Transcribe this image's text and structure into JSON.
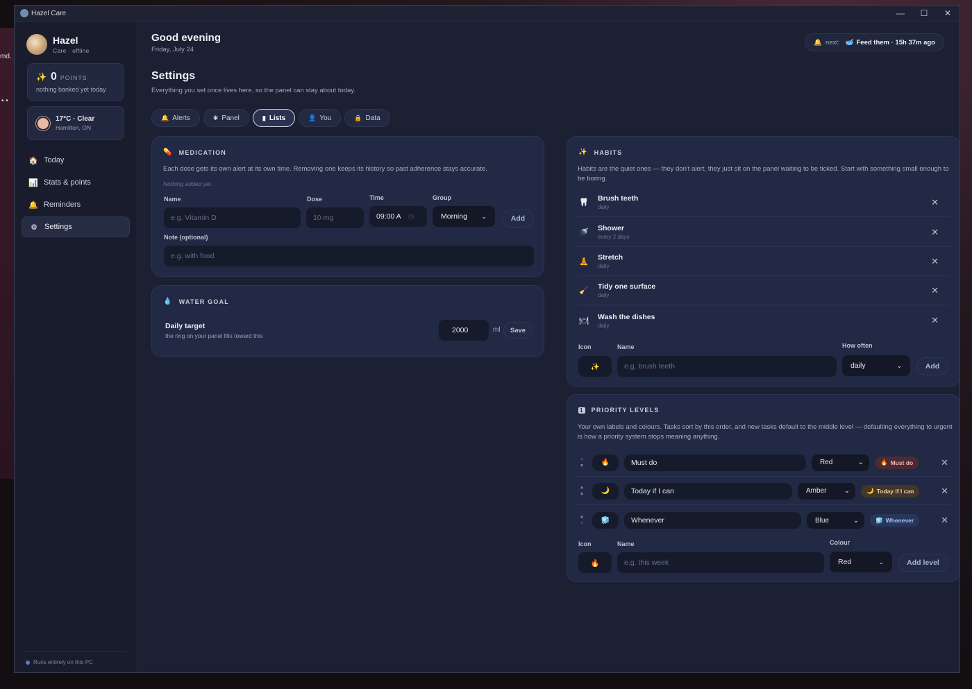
{
  "background": {
    "left_text": "md.",
    "left_dots": "• •"
  },
  "window": {
    "title": "Hazel Care",
    "controls": {
      "minimize": "—",
      "maximize": "☐",
      "close": "✕"
    }
  },
  "sidebar": {
    "name": "Hazel",
    "status": "Care · offline",
    "points": {
      "value": "0",
      "label": "POINTS",
      "sub": "nothing banked yet today"
    },
    "weather": {
      "temp": "17°C · Clear",
      "location": "Hamilton, ON"
    },
    "nav": [
      {
        "label": "Today",
        "icon": "🏠"
      },
      {
        "label": "Stats & points",
        "icon": "📊"
      },
      {
        "label": "Reminders",
        "icon": "🔔"
      },
      {
        "label": "Settings",
        "icon": "⚙"
      }
    ],
    "footer": "Runs entirely on this PC"
  },
  "header": {
    "greeting": "Good evening",
    "date": "Friday, July 24",
    "next_label": "next:",
    "next_value": "Feed them · 15h 37m ago"
  },
  "settings": {
    "title": "Settings",
    "subtitle": "Everything you set once lives here, so the panel can stay about today.",
    "tabs": [
      {
        "label": "Alerts",
        "icon": "🔔"
      },
      {
        "label": "Panel",
        "icon": "✱"
      },
      {
        "label": "Lists",
        "icon": "▮"
      },
      {
        "label": "You",
        "icon": "👤"
      },
      {
        "label": "Data",
        "icon": "🔒"
      }
    ]
  },
  "medication": {
    "title": "MEDICATION",
    "desc": "Each dose gets its own alert at its own time. Removing one keeps its history so past adherence stays accurate.",
    "empty": "Nothing added yet.",
    "labels": {
      "name": "Name",
      "dose": "Dose",
      "time": "Time",
      "group": "Group",
      "note": "Note (optional)"
    },
    "placeholders": {
      "name": "e.g. Vitamin D",
      "dose": "10 mg",
      "note": "e.g. with food"
    },
    "time_value": "09:00 A",
    "group_value": "Morning",
    "add": "Add"
  },
  "water": {
    "title": "WATER GOAL",
    "label": "Daily target",
    "sub": "the ring on your panel fills toward this",
    "value": "2000",
    "unit": "ml",
    "save": "Save"
  },
  "habits": {
    "title": "HABITS",
    "desc": "Habits are the quiet ones — they don't alert, they just sit on the panel waiting to be ticked. Start with something small enough to be boring.",
    "items": [
      {
        "name": "Brush teeth",
        "freq": "daily",
        "icon": "🦷"
      },
      {
        "name": "Shower",
        "freq": "every 2 days",
        "icon": "🚿"
      },
      {
        "name": "Stretch",
        "freq": "daily",
        "icon": "🧘"
      },
      {
        "name": "Tidy one surface",
        "freq": "daily",
        "icon": "🧹"
      },
      {
        "name": "Wash the dishes",
        "freq": "daily",
        "icon": "🍽"
      }
    ],
    "labels": {
      "icon": "Icon",
      "name": "Name",
      "how": "How often"
    },
    "new_icon": "✨",
    "placeholder": "e.g. brush teeth",
    "freq_value": "daily",
    "add": "Add"
  },
  "priority": {
    "title": "PRIORITY LEVELS",
    "desc": "Your own labels and colours. Tasks sort by this order, and new tasks default to the middle level — defaulting everything to urgent is how a priority system stops meaning anything.",
    "levels": [
      {
        "name": "Must do",
        "colour": "Red",
        "icon": "🔥",
        "badge": "Must do",
        "badge_bg": "#4a2a33",
        "badge_fg": "#f0b4b4"
      },
      {
        "name": "Today if I can",
        "colour": "Amber",
        "icon": "🌙",
        "badge": "Today if I can",
        "badge_bg": "#43362a",
        "badge_fg": "#f0d2a8"
      },
      {
        "name": "Whenever",
        "colour": "Blue",
        "icon": "🧊",
        "badge": "Whenever",
        "badge_bg": "#27365a",
        "badge_fg": "#a8c0ef"
      }
    ],
    "labels": {
      "icon": "Icon",
      "name": "Name",
      "colour": "Colour"
    },
    "new_icon": "🔥",
    "placeholder": "e.g. this week",
    "colour_value": "Red",
    "add": "Add level"
  }
}
